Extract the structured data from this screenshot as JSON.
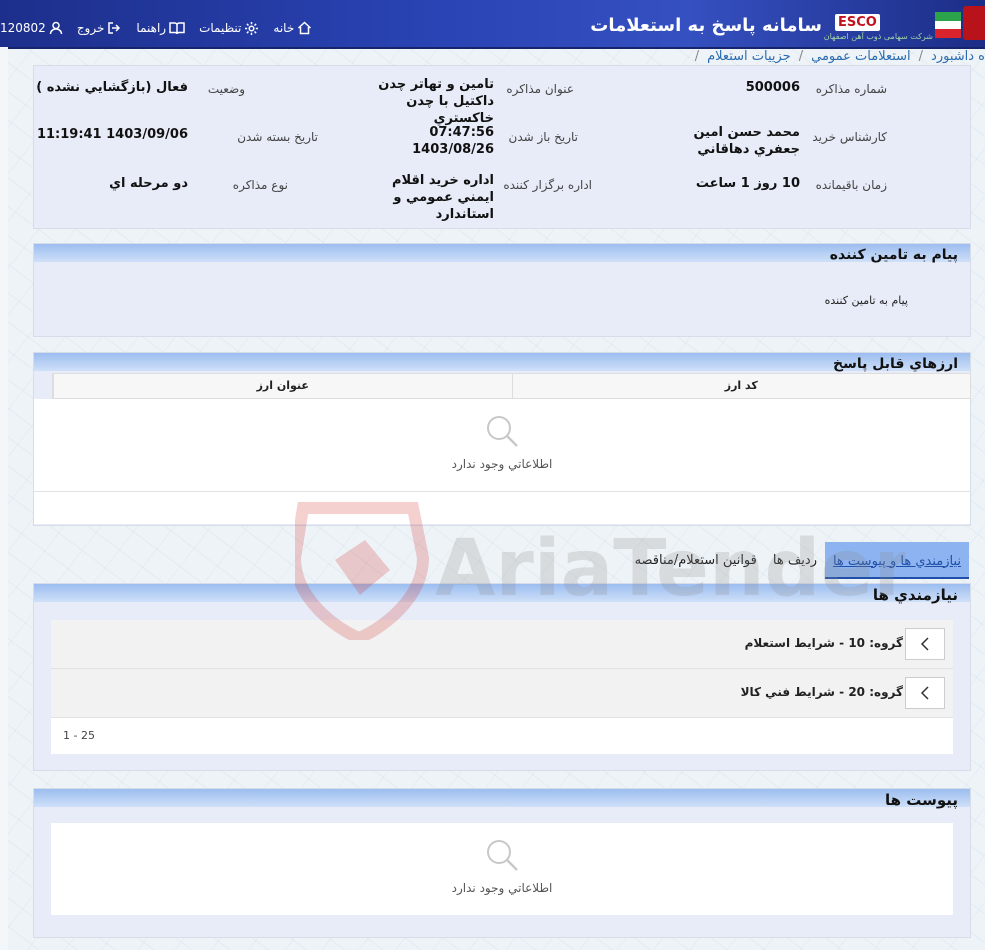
{
  "header": {
    "app_title": "سامانه پاسخ به استعلامات",
    "logo_badge": "ESCO",
    "logo_caption": "شرکت سهامی ذوب آهن اصفهان",
    "user_id": "120802",
    "nav": {
      "logout": "خروج",
      "help": "راهنما",
      "settings": "تنظيمات",
      "home": "خانه"
    }
  },
  "breadcrumb": [
    "ه داشبورد",
    "استعلامات عمومي",
    "جزييات استعلام"
  ],
  "info": {
    "negotiation_number_label": "شماره مذاكره",
    "negotiation_number": "500006",
    "negotiation_title_label": "عنوان مذاكره",
    "negotiation_title": "تامين و تهاتر چدن داكتيل با چدن خاكستري",
    "status_label": "وضعيت",
    "status": "فعال (بازگشايي نشده )",
    "buyer_expert_label": "كارشناس خريد",
    "buyer_expert": "محمد حسن امين جعفري دهاقاني",
    "open_date_label": "تاريخ باز شدن",
    "open_time": "07:47:56",
    "open_date": "1403/08/26",
    "close_date_label": "تاريخ بسته شدن",
    "close_date": "1403/09/06 11:19:41",
    "remaining_label": "زمان باقيمانده",
    "remaining": "10 روز 1 ساعت",
    "organizer_label": "اداره برگزار كننده",
    "organizer": "اداره خريد اقلام ايمني عمومي و استاندارد",
    "type_label": "نوع مذاكره",
    "type": "دو مرحله اي"
  },
  "supplier_message": {
    "title": "پيام به تامين كننده",
    "text": "پيام به تامين كننده"
  },
  "currencies": {
    "title": "ارزهاي قابل پاسخ",
    "columns": [
      "كد ارز",
      "عنوان ارز"
    ],
    "empty_text": "اطلاعاتي وجود ندارد"
  },
  "tabs": [
    "نيازمندي ها و پيوست ها",
    "رديف ها",
    "قوانين استعلام/مناقصه"
  ],
  "requirements": {
    "title": "نيازمندي ها",
    "groups": [
      {
        "label": "گروه: 10 - شرايط استعلام"
      },
      {
        "label": "گروه: 20 - شرايط فني كالا"
      }
    ],
    "pager": "1 - 25"
  },
  "attachments": {
    "title": "پيوست ها",
    "empty_text": "اطلاعاتي وجود ندارد"
  },
  "watermark": "AriaTender.neT",
  "colors": {
    "header": "#2a44b5",
    "panel": "#e7ecf8",
    "bar": "#9cbdf0",
    "link": "#2b6cb0"
  }
}
